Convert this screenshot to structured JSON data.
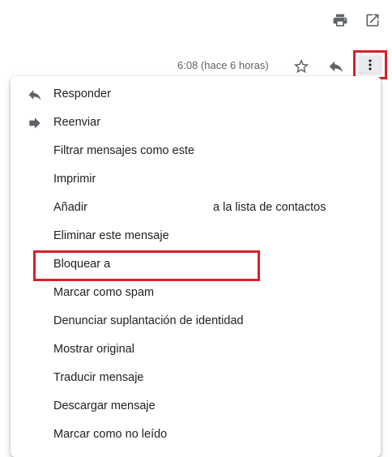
{
  "toolbar": {
    "print_icon": "print-icon",
    "open_new_window_icon": "open-in-new-window-icon"
  },
  "message_header": {
    "timestamp": "6:08 (hace 6 horas)",
    "star_icon": "star-outline-icon",
    "reply_icon": "reply-icon",
    "more_icon": "more-vertical-icon"
  },
  "menu": {
    "items": [
      {
        "label": "Responder",
        "icon": "reply-icon"
      },
      {
        "label": "Reenviar",
        "icon": "forward-icon"
      },
      {
        "label": "Filtrar mensajes como este"
      },
      {
        "label": "Imprimir"
      },
      {
        "label": "Añadir",
        "label_suffix": "a la lista de contactos"
      },
      {
        "label": "Eliminar este mensaje"
      },
      {
        "label": "Bloquear a"
      },
      {
        "label": "Marcar como spam"
      },
      {
        "label": "Denunciar suplantación de identidad"
      },
      {
        "label": "Mostrar original"
      },
      {
        "label": "Traducir mensaje"
      },
      {
        "label": "Descargar mensaje"
      },
      {
        "label": "Marcar como no leído"
      }
    ]
  },
  "colors": {
    "highlight": "#d9202a",
    "icon": "#5f6368",
    "text": "#202124"
  }
}
